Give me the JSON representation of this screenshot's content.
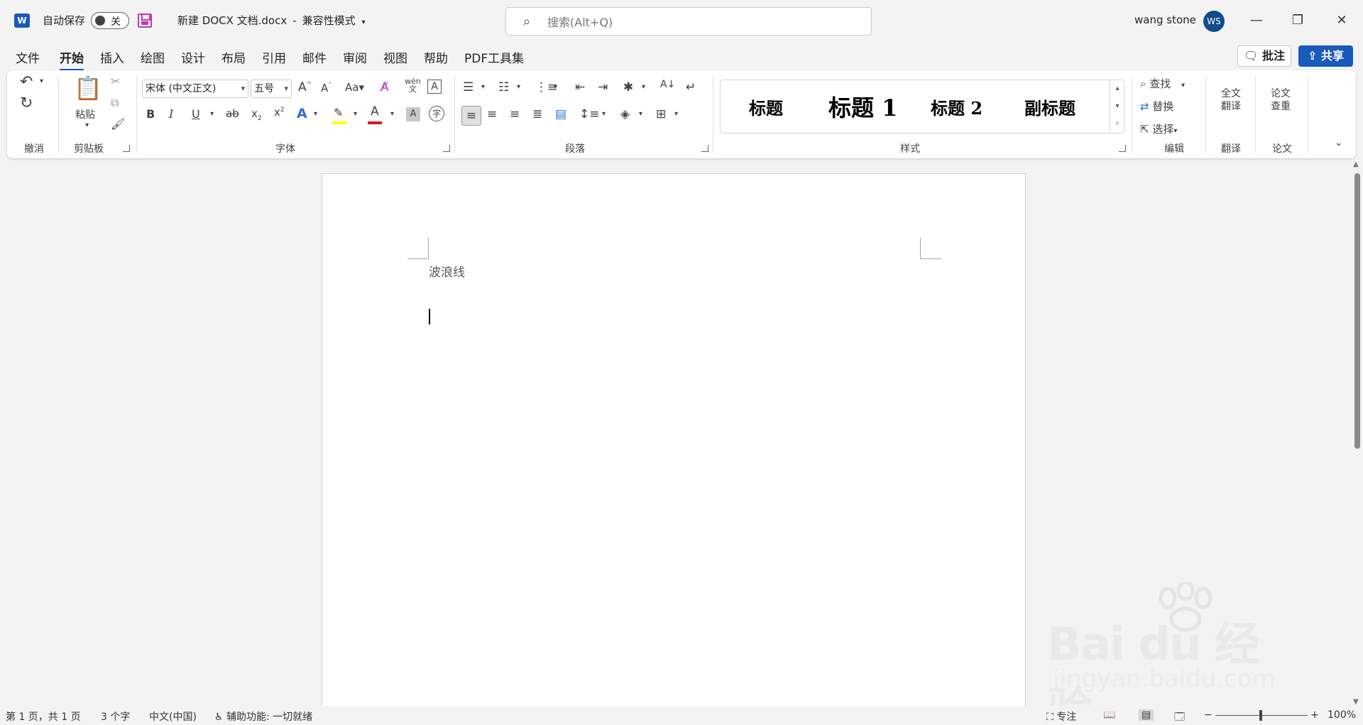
{
  "titlebar": {
    "app_logo": "W",
    "autosave_label": "自动保存",
    "autosave_state": "关",
    "doc_name": "新建 DOCX 文档.docx",
    "separator": "-",
    "mode": "兼容性模式",
    "search_placeholder": "搜索(Alt+Q)",
    "user_name": "wang stone",
    "user_initials": "WS"
  },
  "menu": {
    "tabs": [
      "文件",
      "开始",
      "插入",
      "绘图",
      "设计",
      "布局",
      "引用",
      "邮件",
      "审阅",
      "视图",
      "帮助",
      "PDF工具集"
    ],
    "active_tab": "开始",
    "comment_label": "批注",
    "share_label": "共享"
  },
  "ribbon": {
    "groups": {
      "undo": "撤消",
      "clipboard": "剪贴板",
      "font": "字体",
      "paragraph": "段落",
      "styles": "样式",
      "editing": "编辑",
      "translate": "翻译",
      "paper": "论文"
    },
    "paste_label": "粘贴",
    "font_name": "宋体 (中文正文)",
    "font_size": "五号",
    "styles": [
      "标题",
      "标题 1",
      "标题 2",
      "副标题"
    ],
    "find_label": "查找",
    "replace_label": "替换",
    "select_label": "选择",
    "translate_btn": [
      "全文",
      "翻译"
    ],
    "paper_btn": [
      "论文",
      "查重"
    ]
  },
  "document": {
    "text": "波浪线"
  },
  "statusbar": {
    "page": "第 1 页，共 1 页",
    "words": "3 个字",
    "language": "中文(中国)",
    "accessibility": "辅助功能: 一切就绪",
    "focus": "专注",
    "zoom": "100%"
  },
  "watermark": {
    "brand": "Bai du 经验",
    "url": "jingyan.baidu.com"
  },
  "colors": {
    "accent": "#185abd",
    "save_icon": "#c239b3",
    "highlight": "#ffff00",
    "font_color": "#e81123"
  }
}
